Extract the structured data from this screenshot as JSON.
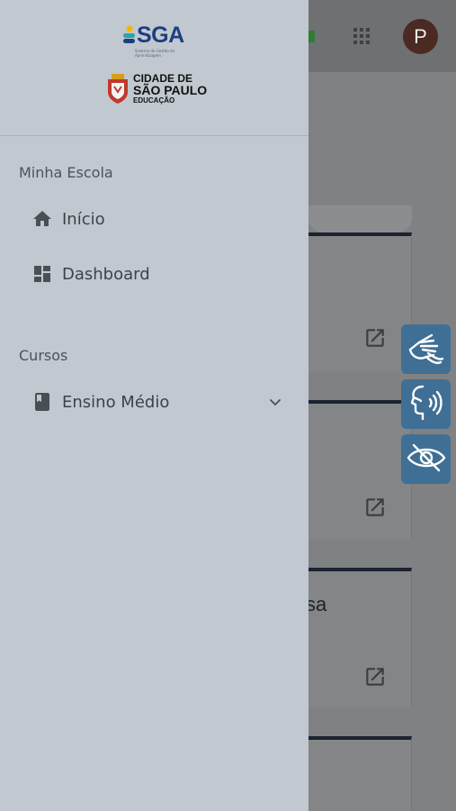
{
  "topbar": {
    "avatar_initial": "P",
    "apps_icon": "apps-grid-icon"
  },
  "background_cards": [
    {
      "text": "",
      "icon": "open-external-icon"
    },
    {
      "text": "",
      "icon": "open-external-icon"
    },
    {
      "text": "sa",
      "icon": "open-external-icon"
    }
  ],
  "accessibility": [
    {
      "icon": "sign-language-icon",
      "label": "Libras"
    },
    {
      "icon": "voice-reader-icon",
      "label": "Leitor de voz"
    },
    {
      "icon": "visual-contrast-icon",
      "label": "Alto contraste"
    }
  ],
  "drawer": {
    "logo_sga": {
      "text": "SGA",
      "subtitle": "Sistema de Gestão da Aprendizagem"
    },
    "logo_sp": {
      "line1": "CIDADE DE",
      "line2": "SÃO PAULO",
      "line3": "EDUCAÇÃO"
    },
    "sections": [
      {
        "title": "Minha Escola",
        "items": [
          {
            "label": "Início",
            "icon": "home-icon"
          },
          {
            "label": "Dashboard",
            "icon": "dashboard-icon"
          }
        ]
      },
      {
        "title": "Cursos",
        "items": [
          {
            "label": "Ensino Médio",
            "icon": "book-icon",
            "expandable": true
          }
        ]
      }
    ]
  },
  "colors": {
    "drawer_bg": "#c1c8cf",
    "scrim": "#808182",
    "accent_blue": "#3f6f95",
    "brand_blue": "#1c3f82"
  }
}
